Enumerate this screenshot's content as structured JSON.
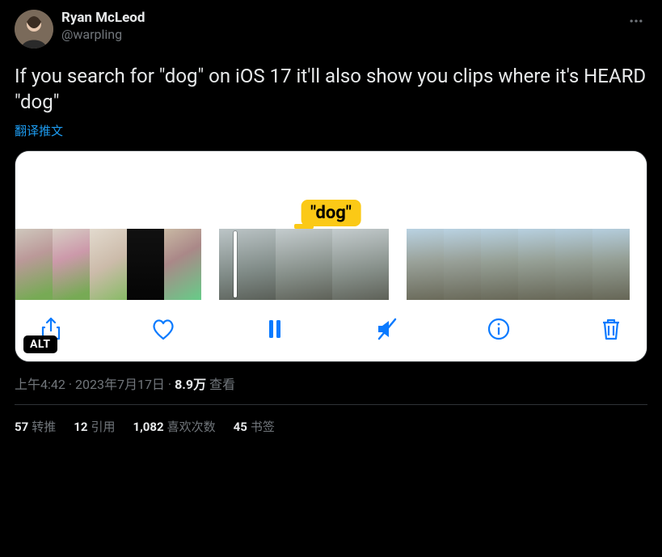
{
  "author": {
    "display_name": "Ryan McLeod",
    "handle": "@warpling"
  },
  "tweet_text": "If you search for \"dog\" on iOS 17 it'll also show you clips where it's HEARD \"dog\"",
  "translate_label": "翻译推文",
  "media": {
    "highlight_label": "\"dog\"",
    "alt_badge": "ALT"
  },
  "meta": {
    "time": "上午4:42",
    "dot1": " · ",
    "date": "2023年7月17日",
    "dot2": " · ",
    "views_count": "8.9万",
    "views_label": " 查看"
  },
  "stats": {
    "retweets_n": "57",
    "retweets_label": "转推",
    "quotes_n": "12",
    "quotes_label": "引用",
    "likes_n": "1,082",
    "likes_label": "喜欢次数",
    "bookmarks_n": "45",
    "bookmarks_label": "书签"
  }
}
